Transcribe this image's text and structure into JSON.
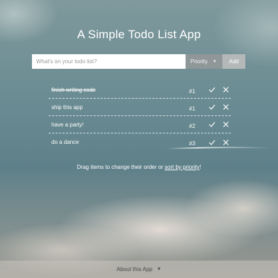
{
  "app": {
    "title": "A Simple Todo List App"
  },
  "add_bar": {
    "placeholder": "What's on your todo list?",
    "priority_label": "Priority",
    "add_label": "Add"
  },
  "todos": [
    {
      "text": "finish writing code",
      "priority": "#1",
      "done": true
    },
    {
      "text": "ship this app",
      "priority": "#1",
      "done": false
    },
    {
      "text": "have a party!",
      "priority": "#2",
      "done": false
    },
    {
      "text": "do a dance",
      "priority": "#3",
      "done": false
    }
  ],
  "footer": {
    "hint_prefix": "Drag items to change their order or ",
    "hint_link": "sort by priority",
    "hint_suffix": "!"
  },
  "about": {
    "label": "About this App"
  }
}
